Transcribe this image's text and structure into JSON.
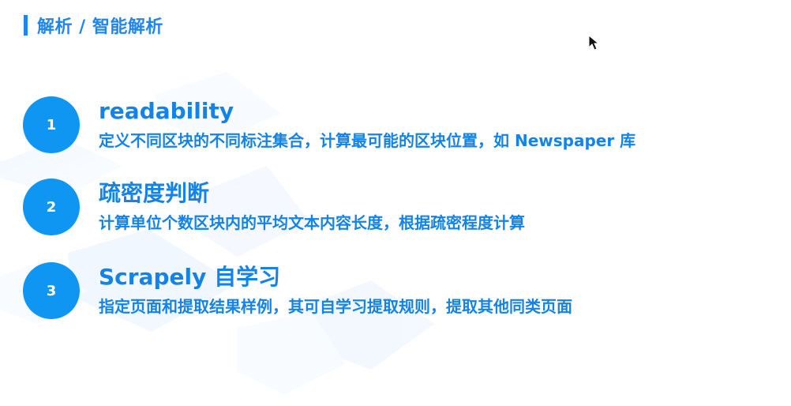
{
  "header": {
    "title": "解析 / 智能解析"
  },
  "items": [
    {
      "number": "1",
      "title": "readability",
      "description": "定义不同区块的不同标注集合，计算最可能的区块位置，如 Newspaper 库"
    },
    {
      "number": "2",
      "title": "疏密度判断",
      "description": "计算单位个数区块内的平均文本内容长度，根据疏密程度计算"
    },
    {
      "number": "3",
      "title": "Scrapely 自学习",
      "description": "指定页面和提取结果样例，其可自学习提取规则，提取其他同类页面"
    }
  ],
  "colors": {
    "accent": "#1383e8",
    "circle": "#0f96f2",
    "header": "#1f86f0"
  },
  "icons": {
    "cursor": "mouse-pointer-icon"
  }
}
